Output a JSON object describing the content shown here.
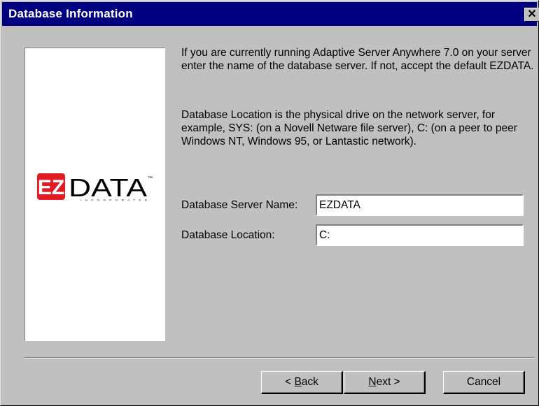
{
  "window": {
    "title": "Database Information",
    "close_glyph": "✕"
  },
  "logo": {
    "mark_text": "EZ",
    "word_text": "DATA",
    "tagline": "INCORPORATED",
    "trademark": "™",
    "brand_red": "#e31b23",
    "brand_black": "#000000"
  },
  "instructions": {
    "paragraph1": "If you are currently running Adaptive Server Anywhere 7.0 on your server enter the name of the database server. If not, accept the default EZDATA.",
    "paragraph2": "Database Location is the physical drive on the network server, for example, SYS: (on a Novell Netware file server), C: (on a peer to peer Windows NT, Windows 95, or Lantastic network)."
  },
  "form": {
    "server_name_label": "Database Server Name:",
    "server_name_value": "EZDATA",
    "location_label": "Database Location:",
    "location_value": "C:"
  },
  "buttons": {
    "back_prefix": "< ",
    "back_accel": "B",
    "back_rest": "ack",
    "next_accel": "N",
    "next_rest": "ext >",
    "cancel": "Cancel"
  },
  "colors": {
    "title_bar": "#000080",
    "dialog_face": "#c0c0c0"
  }
}
